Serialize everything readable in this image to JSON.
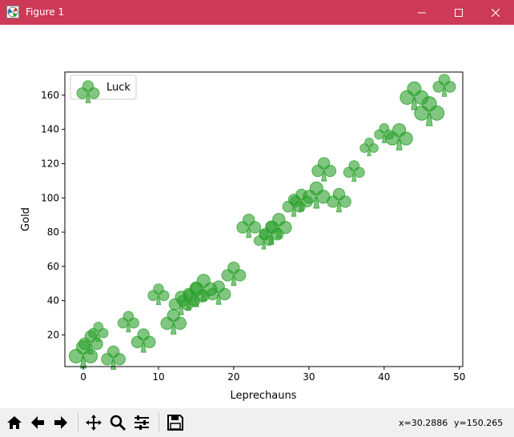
{
  "window": {
    "title": "Figure 1"
  },
  "toolbar": {
    "coords_x": "x=30.2886",
    "coords_y": "y=150.265"
  },
  "chart_data": {
    "type": "scatter",
    "xlabel": "Leprechauns",
    "ylabel": "Gold",
    "xlim": [
      -2.45,
      50.45
    ],
    "ylim": [
      1.5,
      173.5
    ],
    "xticks": [
      0,
      10,
      20,
      30,
      40,
      50
    ],
    "yticks": [
      20,
      40,
      60,
      80,
      100,
      120,
      140,
      160
    ],
    "legend": {
      "location": "upper-left",
      "entries": [
        "Luck"
      ]
    },
    "marker": "club",
    "color": "#2ca02c",
    "series": [
      {
        "name": "Luck",
        "points": [
          {
            "x": 0,
            "y": 9,
            "s": 1.0
          },
          {
            "x": 1,
            "y": 16,
            "s": 0.85
          },
          {
            "x": 2,
            "y": 22,
            "s": 0.7
          },
          {
            "x": 4,
            "y": 7,
            "s": 0.85
          },
          {
            "x": 6,
            "y": 28,
            "s": 0.75
          },
          {
            "x": 8,
            "y": 17,
            "s": 0.85
          },
          {
            "x": 10,
            "y": 44,
            "s": 0.75
          },
          {
            "x": 12,
            "y": 28,
            "s": 0.9
          },
          {
            "x": 13,
            "y": 39,
            "s": 0.85
          },
          {
            "x": 14,
            "y": 41,
            "s": 0.8
          },
          {
            "x": 15,
            "y": 44,
            "s": 0.9
          },
          {
            "x": 16,
            "y": 48,
            "s": 0.95
          },
          {
            "x": 18,
            "y": 45,
            "s": 0.85
          },
          {
            "x": 20,
            "y": 56,
            "s": 0.85
          },
          {
            "x": 22,
            "y": 84,
            "s": 0.85
          },
          {
            "x": 24,
            "y": 76,
            "s": 0.7
          },
          {
            "x": 25,
            "y": 80,
            "s": 0.85
          },
          {
            "x": 26,
            "y": 84,
            "s": 0.9
          },
          {
            "x": 28,
            "y": 96,
            "s": 0.8
          },
          {
            "x": 29,
            "y": 99,
            "s": 0.8
          },
          {
            "x": 31,
            "y": 102,
            "s": 0.95
          },
          {
            "x": 32,
            "y": 117,
            "s": 0.85
          },
          {
            "x": 34,
            "y": 99,
            "s": 0.85
          },
          {
            "x": 36,
            "y": 116,
            "s": 0.75
          },
          {
            "x": 38,
            "y": 130,
            "s": 0.65
          },
          {
            "x": 40,
            "y": 138,
            "s": 0.7
          },
          {
            "x": 42,
            "y": 136,
            "s": 0.95
          },
          {
            "x": 44,
            "y": 160,
            "s": 1.0
          },
          {
            "x": 46,
            "y": 151,
            "s": 1.05
          },
          {
            "x": 48,
            "y": 166,
            "s": 0.8
          }
        ]
      }
    ]
  }
}
